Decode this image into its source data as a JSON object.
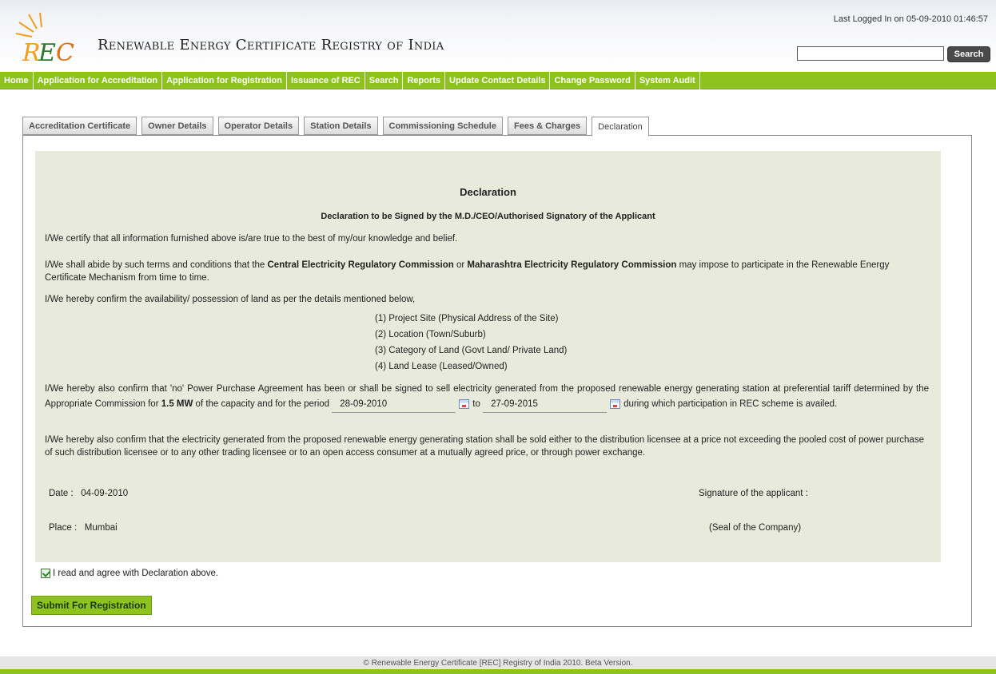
{
  "header": {
    "title": "Renewable Energy Certificate Registry of India",
    "last_login": "Last Logged In on 05-09-2010 01:46:57",
    "search_button": "Search",
    "search_value": ""
  },
  "nav": [
    "Home",
    "Application for Accreditation",
    "Application for Registration",
    "Issuance of REC",
    "Search",
    "Reports",
    "Update Contact Details",
    "Change Password",
    "System Audit"
  ],
  "tabs": [
    "Accreditation Certificate",
    "Owner Details",
    "Operator Details",
    "Station Details",
    "Commissioning Schedule",
    "Fees & Charges",
    "Declaration"
  ],
  "active_tab": "Declaration",
  "declaration": {
    "title": "Declaration",
    "subtitle": "Declaration to be Signed by the M.D./CEO/Authorised Signatory of the Applicant",
    "p1": "I/We certify that all information furnished above is/are true to the best of my/our knowledge and belief.",
    "p2_a": "I/We shall abide by such terms and conditions that the ",
    "p2_b": "Central Electricity Regulatory Commission",
    "p2_c": " or ",
    "p2_d": "Maharashtra Electricity Regulatory Commission",
    "p2_e": " may impose to participate in the Renewable Energy Certificate Mechanism from time to time.",
    "p3": "I/We hereby confirm the availability/ possession of land as per the details mentioned below,",
    "list": [
      "(1) Project Site (Physical Address of the Site)",
      "(2) Location (Town/Suburb)",
      "(3) Category of Land (Govt Land/ Private Land)",
      "(4) Land Lease (Leased/Owned)"
    ],
    "p4_a": "I/We hereby also confirm that 'no' Power Purchase Agreement has been or shall be signed to sell electricity generated from the proposed renewable energy generating station at preferential tariff determined by the Appropriate Commission for ",
    "p4_capacity": "1.5 MW",
    "p4_b": " of the capacity and for the period",
    "period_from": "28-09-2010",
    "to_label": "to",
    "period_to": "27-09-2015",
    "p4_c": "during which participation in REC scheme is availed.",
    "p5": "I/We hereby also confirm that the electricity generated from the proposed renewable energy generating station shall be sold either to the distribution licensee at a price not exceeding the pooled cost of power purchase of such distribution licensee or to any other trading licensee or to an open access consumer at a mutually agreed price, or through power exchange.",
    "date_label": "Date :",
    "date_value": "04-09-2010",
    "place_label": "Place :",
    "place_value": "Mumbai",
    "signature_label": "Signature of the applicant :",
    "seal_label": "(Seal of the Company)"
  },
  "agree_label": "I read and agree with Declaration above.",
  "submit_label": "Submit For Registration",
  "footer": "© Renewable Energy Certificate [REC] Registry of India 2010. Beta Version.",
  "colors": {
    "nav_green": "#8ec31f",
    "panel_bg": "#e8eadb"
  }
}
